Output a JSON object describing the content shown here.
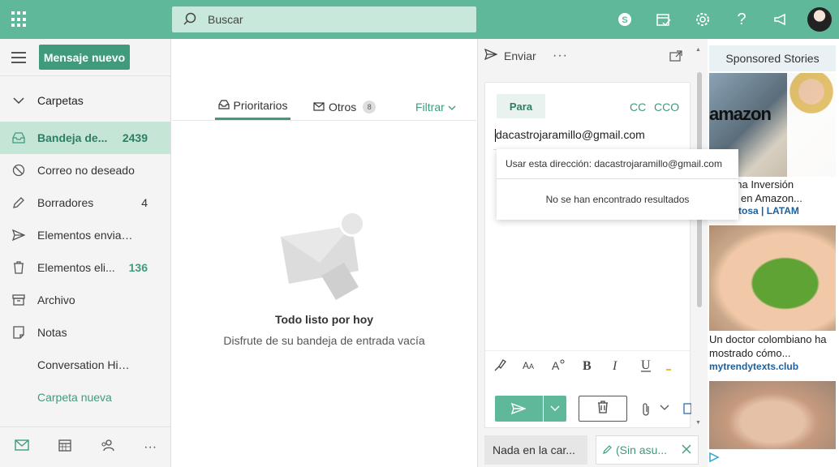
{
  "topbar": {
    "search_placeholder": "Buscar",
    "icons": [
      "apps-icon",
      "skype-icon",
      "calendar-check-icon",
      "gear-icon",
      "help-icon",
      "megaphone-icon",
      "avatar"
    ],
    "help_label": "?"
  },
  "leftnav": {
    "new_message_label": "Mensaje nuevo",
    "folders_header": "Carpetas",
    "folders": [
      {
        "label": "Bandeja de...",
        "count": "2439"
      },
      {
        "label": "Correo no deseado",
        "count": ""
      },
      {
        "label": "Borradores",
        "count": "4"
      },
      {
        "label": "Elementos enviad...",
        "count": ""
      },
      {
        "label": "Elementos eli...",
        "count": "136"
      },
      {
        "label": "Archivo",
        "count": ""
      },
      {
        "label": "Notas",
        "count": ""
      },
      {
        "label": "Conversation Hist...",
        "count": ""
      },
      {
        "label": "Carpeta nueva",
        "count": ""
      }
    ],
    "more_label": "···"
  },
  "message_list": {
    "tab_focused": "Prioritarios",
    "tab_other": "Otros",
    "tab_other_count": "8",
    "filter_label": "Filtrar",
    "empty_title": "Todo listo por hoy",
    "empty_subtitle": "Disfrute de su bandeja de entrada vacía"
  },
  "compose": {
    "send_label": "Enviar",
    "more_label": "···",
    "to_label": "Para",
    "cc_label": "CC",
    "bcc_label": "CCO",
    "to_value": "dacastrojaramillo@gmail.com",
    "suggest_use_address": "Usar esta dirección: dacastrojaramillo@gmail.com",
    "suggest_no_results": "No se han encontrado resultados",
    "draft_tab_1": "Nada en la car...",
    "draft_tab_2": "(Sin asu..."
  },
  "ads": {
    "header": "Sponsored Stories",
    "ad1_brand_text": "amazon",
    "ad1_title": "erte una Inversión\nOUS$ en Amazon...",
    "ad1_source": "ón Exitosa | LATAM",
    "ad2_title": "Un doctor colombiano ha mostrado cómo...",
    "ad2_source": "mytrendytexts.club"
  },
  "colors": {
    "accent": "#5fb89a",
    "accent_dark": "#3f9b7c",
    "selected_bg": "#c5e5d7",
    "link_blue": "#1a5f9e"
  }
}
